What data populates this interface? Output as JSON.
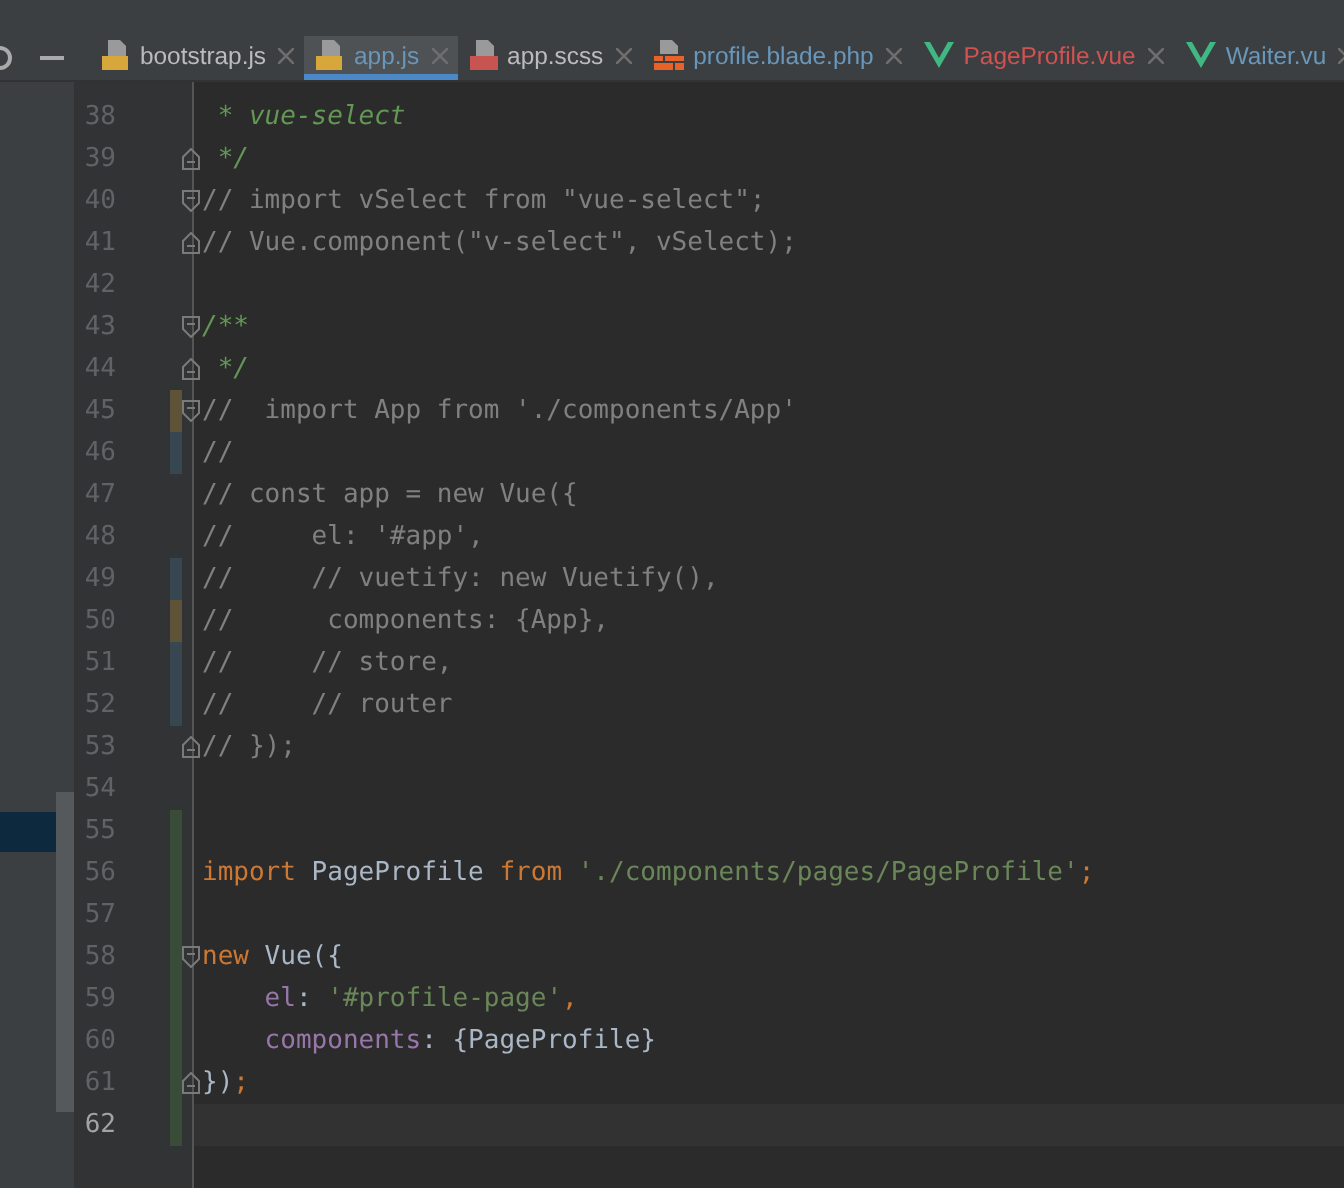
{
  "tabs": [
    {
      "label": "bootstrap.js",
      "kind": "js",
      "color": "#bbbbbb",
      "selected": false
    },
    {
      "label": "app.js",
      "kind": "js",
      "color": "#6897bb",
      "selected": true
    },
    {
      "label": "app.scss",
      "kind": "sass",
      "color": "#bbbbbb",
      "selected": false
    },
    {
      "label": "profile.blade.php",
      "kind": "php",
      "color": "#6897bb",
      "selected": false
    },
    {
      "label": "PageProfile.vue",
      "kind": "vue",
      "color": "#d25252",
      "selected": false
    },
    {
      "label": "Waiter.vu",
      "kind": "vue",
      "color": "#6897bb",
      "selected": false
    }
  ],
  "lines": [
    {
      "number": "38",
      "tokens": [
        {
          "kind": "doc",
          "text": " * vue-select"
        }
      ]
    },
    {
      "number": "39",
      "fold_end": true,
      "tokens": [
        {
          "kind": "doc",
          "text": " */"
        }
      ]
    },
    {
      "number": "40",
      "fold_start": true,
      "tokens": [
        {
          "kind": "comment",
          "text": "// import vSelect from \"vue-select\";"
        }
      ]
    },
    {
      "number": "41",
      "fold_end": true,
      "tokens": [
        {
          "kind": "comment",
          "text": "// Vue.component(\"v-select\", vSelect);"
        }
      ]
    },
    {
      "number": "42"
    },
    {
      "number": "43",
      "fold_start": true,
      "tokens": [
        {
          "kind": "doc",
          "text": "/**"
        }
      ]
    },
    {
      "number": "44",
      "fold_end": true,
      "tokens": [
        {
          "kind": "doc",
          "text": " */"
        }
      ]
    },
    {
      "number": "45",
      "fold_start": true,
      "color": "#5e5339",
      "tokens": [
        {
          "kind": "comment",
          "text": "//  import App from './components/App'"
        }
      ]
    },
    {
      "number": "46",
      "color": "#374752",
      "tokens": [
        {
          "kind": "comment",
          "text": "//"
        }
      ]
    },
    {
      "number": "47",
      "tokens": [
        {
          "kind": "comment",
          "text": "// const app = new Vue({"
        }
      ]
    },
    {
      "number": "48",
      "tokens": [
        {
          "kind": "comment",
          "text": "//     el: '#app',"
        }
      ]
    },
    {
      "number": "49",
      "color": "#374752",
      "tokens": [
        {
          "kind": "comment",
          "text": "//     // vuetify: new Vuetify(),"
        }
      ]
    },
    {
      "number": "50",
      "color": "#5e5339",
      "tokens": [
        {
          "kind": "comment",
          "text": "//      components: {App},"
        }
      ]
    },
    {
      "number": "51",
      "color": "#374752",
      "tokens": [
        {
          "kind": "comment",
          "text": "//     // store,"
        }
      ]
    },
    {
      "number": "52",
      "color": "#374752",
      "tokens": [
        {
          "kind": "comment",
          "text": "//     // router"
        }
      ]
    },
    {
      "number": "53",
      "fold_end": true,
      "tokens": [
        {
          "kind": "comment",
          "text": "// });"
        }
      ]
    },
    {
      "number": "54"
    },
    {
      "number": "55",
      "color": "#384c38"
    },
    {
      "number": "56",
      "color": "#384c38",
      "tokens": [
        {
          "kind": "keyword",
          "text": "import"
        },
        {
          "kind": "plain",
          "text": " PageProfile "
        },
        {
          "kind": "keyword",
          "text": "from"
        },
        {
          "kind": "string",
          "text": " './components/pages/PageProfile'"
        },
        {
          "kind": "keyword",
          "text": ";"
        }
      ]
    },
    {
      "number": "57",
      "color": "#384c38"
    },
    {
      "number": "58",
      "fold_start": true,
      "color": "#384c38",
      "tokens": [
        {
          "kind": "keyword",
          "text": "new"
        },
        {
          "kind": "plain",
          "text": " Vue({"
        }
      ]
    },
    {
      "number": "59",
      "color": "#384c38",
      "tokens": [
        {
          "kind": "field",
          "text": "    el"
        },
        {
          "kind": "plain",
          "text": ": "
        },
        {
          "kind": "string",
          "text": "'#profile-page'"
        },
        {
          "kind": "keyword",
          "text": ","
        }
      ]
    },
    {
      "number": "60",
      "color": "#384c38",
      "tokens": [
        {
          "kind": "field",
          "text": "    components"
        },
        {
          "kind": "plain",
          "text": ": {PageProfile}"
        }
      ]
    },
    {
      "number": "61",
      "fold_end": true,
      "color": "#384c38",
      "tokens": [
        {
          "kind": "plain",
          "text": "})"
        },
        {
          "kind": "keyword",
          "text": ";"
        }
      ]
    },
    {
      "number": "62",
      "color": "#384c38",
      "current": true
    }
  ]
}
